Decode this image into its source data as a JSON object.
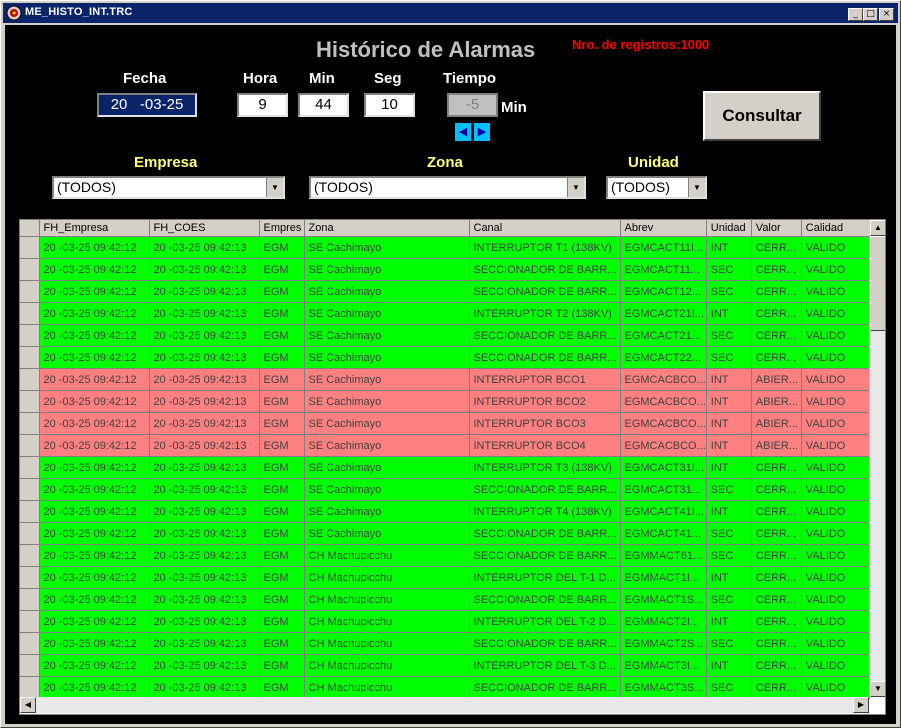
{
  "window": {
    "title": "ME_HISTO_INT.TRC",
    "minimize": "_",
    "maximize": "□",
    "close": "×"
  },
  "header": {
    "title": "Histórico de Alarmas",
    "registros": "Nro. de registros:1000"
  },
  "filters": {
    "fecha_label": "Fecha",
    "fecha_value_a": "20",
    "fecha_value_b": "-03-25",
    "hora_label": "Hora",
    "hora_value": "9",
    "min_label": "Min",
    "min_value": "44",
    "seg_label": "Seg",
    "seg_value": "10",
    "tiempo_label": "Tiempo",
    "tiempo_value": "-5",
    "tiempo_unit": "Min",
    "consultar": "Consultar",
    "empresa_label": "Empresa",
    "empresa_value": "(TODOS)",
    "zona_label": "Zona",
    "zona_value": "(TODOS)",
    "unidad_label": "Unidad",
    "unidad_value": "(TODOS)"
  },
  "grid": {
    "columns": [
      "FH_Empresa",
      "FH_COES",
      "Empres",
      "Zona",
      "Canal",
      "Abrev",
      "Unidad",
      "Valor",
      "Calidad"
    ],
    "rows": [
      {
        "status": "green",
        "cells": [
          "20     -03-25 09:42:12",
          "20     -03-25 09:42:13",
          "EGM",
          "SE Cachimayo",
          "INTERRUPTOR T1 (138KV)",
          "EGMCACT11I...",
          "INT",
          "CERR...",
          "VALIDO"
        ]
      },
      {
        "status": "green",
        "cells": [
          "20     -03-25 09:42:12",
          "20     -03-25 09:42:13",
          "EGM",
          "SE Cachimayo",
          "SECCIONADOR DE BARR...",
          "EGMCACT11...",
          "SEC",
          "CERR...",
          "VALIDO"
        ]
      },
      {
        "status": "green",
        "cells": [
          "20     -03-25 09:42:12",
          "20     -03-25 09:42:13",
          "EGM",
          "SE Cachimayo",
          "SECCIONADOR DE BARR...",
          "EGMCACT12...",
          "SEC",
          "CERR...",
          "VALIDO"
        ]
      },
      {
        "status": "green",
        "cells": [
          "20     -03-25 09:42:12",
          "20     -03-25 09:42:13",
          "EGM",
          "SE Cachimayo",
          "INTERRUPTOR T2 (138KV)",
          "EGMCACT21I...",
          "INT",
          "CERR...",
          "VALIDO"
        ]
      },
      {
        "status": "green",
        "cells": [
          "20     -03-25 09:42:12",
          "20     -03-25 09:42:13",
          "EGM",
          "SE Cachimayo",
          "SECCIONADOR DE BARR...",
          "EGMCACT21...",
          "SEC",
          "CERR...",
          "VALIDO"
        ]
      },
      {
        "status": "green",
        "cells": [
          "20     -03-25 09:42:12",
          "20     -03-25 09:42:13",
          "EGM",
          "SE Cachimayo",
          "SECCIONADOR DE BARR...",
          "EGMCACT22...",
          "SEC",
          "CERR...",
          "VALIDO"
        ]
      },
      {
        "status": "red",
        "cells": [
          "20     -03-25 09:42:12",
          "20     -03-25 09:42:13",
          "EGM",
          "SE Cachimayo",
          "INTERRUPTOR BCO1",
          "EGMCACBCO...",
          "INT",
          "ABIER...",
          "VALIDO"
        ]
      },
      {
        "status": "red",
        "cells": [
          "20     -03-25 09:42:12",
          "20     -03-25 09:42:13",
          "EGM",
          "SE Cachimayo",
          "INTERRUPTOR BCO2",
          "EGMCACBCO...",
          "INT",
          "ABIER...",
          "VALIDO"
        ]
      },
      {
        "status": "red",
        "cells": [
          "20     -03-25 09:42:12",
          "20     -03-25 09:42:13",
          "EGM",
          "SE Cachimayo",
          "INTERRUPTOR BCO3",
          "EGMCACBCO...",
          "INT",
          "ABIER...",
          "VALIDO"
        ]
      },
      {
        "status": "red",
        "cells": [
          "20     -03-25 09:42:12",
          "20     -03-25 09:42:13",
          "EGM",
          "SE Cachimayo",
          "INTERRUPTOR BCO4",
          "EGMCACBCO...",
          "INT",
          "ABIER...",
          "VALIDO"
        ]
      },
      {
        "status": "green",
        "cells": [
          "20     -03-25 09:42:12",
          "20     -03-25 09:42:13",
          "EGM",
          "SE Cachimayo",
          "INTERRUPTOR T3 (138KV)",
          "EGMCACT31I...",
          "INT",
          "CERR...",
          "VALIDO"
        ]
      },
      {
        "status": "green",
        "cells": [
          "20     -03-25 09:42:12",
          "20     -03-25 09:42:13",
          "EGM",
          "SE Cachimayo",
          "SECCIONADOR DE BARR...",
          "EGMCACT31...",
          "SEC",
          "CERR...",
          "VALIDO"
        ]
      },
      {
        "status": "green",
        "cells": [
          "20     -03-25 09:42:12",
          "20     -03-25 09:42:13",
          "EGM",
          "SE Cachimayo",
          "INTERRUPTOR T4 (138KV)",
          "EGMCACT41I...",
          "INT",
          "CERR...",
          "VALIDO"
        ]
      },
      {
        "status": "green",
        "cells": [
          "20     -03-25 09:42:12",
          "20     -03-25 09:42:13",
          "EGM",
          "SE Cachimayo",
          "SECCIONADOR DE BARR...",
          "EGMCACT41...",
          "SEC",
          "CERR...",
          "VALIDO"
        ]
      },
      {
        "status": "green",
        "cells": [
          "20     -03-25 09:42:12",
          "20     -03-25 09:42:13",
          "EGM",
          "CH Machupicchu",
          "SECCIONADOR DE BARR...",
          "EGMMACT61...",
          "SEC",
          "CERR...",
          "VALIDO"
        ]
      },
      {
        "status": "green",
        "cells": [
          "20     -03-25 09:42:12",
          "20     -03-25 09:42:13",
          "EGM",
          "CH Machupicchu",
          "INTERRUPTOR DEL T-1 D...",
          "EGMMACT1I...",
          "INT",
          "CERR...",
          "VALIDO"
        ]
      },
      {
        "status": "green",
        "cells": [
          "20     -03-25 09:42:12",
          "20     -03-25 09:42:13",
          "EGM",
          "CH Machupicchu",
          "SECCIONADOR DE BARR...",
          "EGMMACT1S...",
          "SEC",
          "CERR...",
          "VALIDO"
        ]
      },
      {
        "status": "green",
        "cells": [
          "20     -03-25 09:42:12",
          "20     -03-25 09:42:13",
          "EGM",
          "CH Machupicchu",
          "INTERRUPTOR DEL T-2 D...",
          "EGMMACT2I...",
          "INT",
          "CERR...",
          "VALIDO"
        ]
      },
      {
        "status": "green",
        "cells": [
          "20     -03-25 09:42:12",
          "20     -03-25 09:42:13",
          "EGM",
          "CH Machupicchu",
          "SECCIONADOR DE BARR...",
          "EGMMACT2S...",
          "SEC",
          "CERR...",
          "VALIDO"
        ]
      },
      {
        "status": "green",
        "cells": [
          "20     -03-25 09:42:12",
          "20     -03-25 09:42:13",
          "EGM",
          "CH Machupicchu",
          "INTERRUPTOR DEL T-3 D...",
          "EGMMACT3I...",
          "INT",
          "CERR...",
          "VALIDO"
        ]
      },
      {
        "status": "green",
        "cells": [
          "20     -03-25 09:42:12",
          "20     -03-25 09:42:13",
          "EGM",
          "CH Machupicchu",
          "SECCIONADOR DE BARR...",
          "EGMMACT3S...",
          "SEC",
          "CERR...",
          "VALIDO"
        ]
      }
    ]
  },
  "colors": {
    "green_row": "#00ff00",
    "red_row": "#ff8080",
    "title_bar": "#0a246a",
    "registros_text": "#ff0000",
    "combo_label": "#ffff80"
  },
  "icons": {
    "app": "app-icon",
    "left_arrow": "◀",
    "right_arrow": "▶",
    "dropdown": "▼",
    "scroll_up": "▲",
    "scroll_down": "▼",
    "scroll_left": "◀",
    "scroll_right": "▶"
  }
}
